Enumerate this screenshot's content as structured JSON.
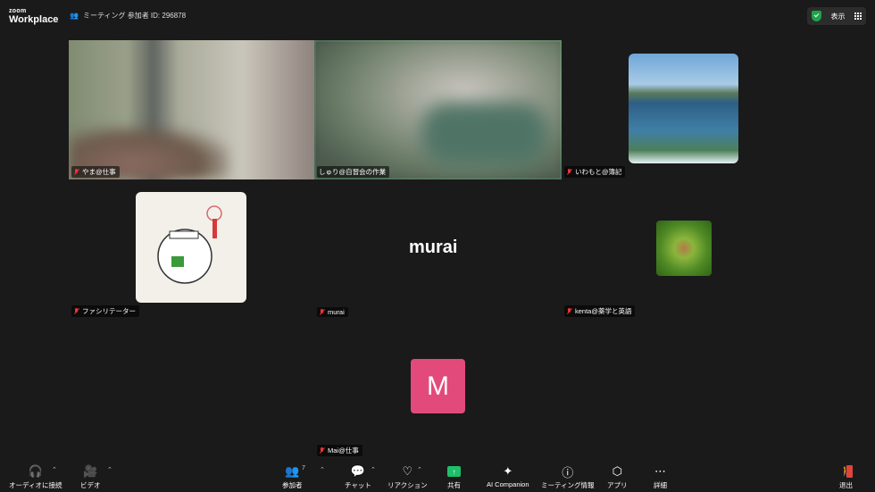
{
  "topbar": {
    "brand_small": "zoom",
    "brand_large": "Workplace",
    "meeting_label": "ミーティング 参加者 ID: 296878",
    "view_label": "表示"
  },
  "participants": [
    {
      "name": "やま@仕事"
    },
    {
      "name": "しゅり@自習会の作業"
    },
    {
      "name": "いわもと@簿記"
    },
    {
      "name": "ファシリテーター"
    },
    {
      "name": "murai",
      "display_name": "murai"
    },
    {
      "name": "kenta@薬学と英語"
    },
    {
      "name": "Mai@仕事",
      "initial": "M",
      "avatar_color": "#e34a7c"
    }
  ],
  "toolbar": {
    "audio": "オーディオに接続",
    "video": "ビデオ",
    "participants": "参加者",
    "participants_count": "7",
    "chat": "チャット",
    "reactions": "リアクション",
    "share": "共有",
    "ai_companion": "AI Companion",
    "meeting_info": "ミーティング情報",
    "apps": "アプリ",
    "more": "詳細",
    "leave": "退出"
  },
  "colors": {
    "active_speaker": "#3ad28a",
    "share": "#1fbe6a",
    "leave": "#e0443a"
  }
}
